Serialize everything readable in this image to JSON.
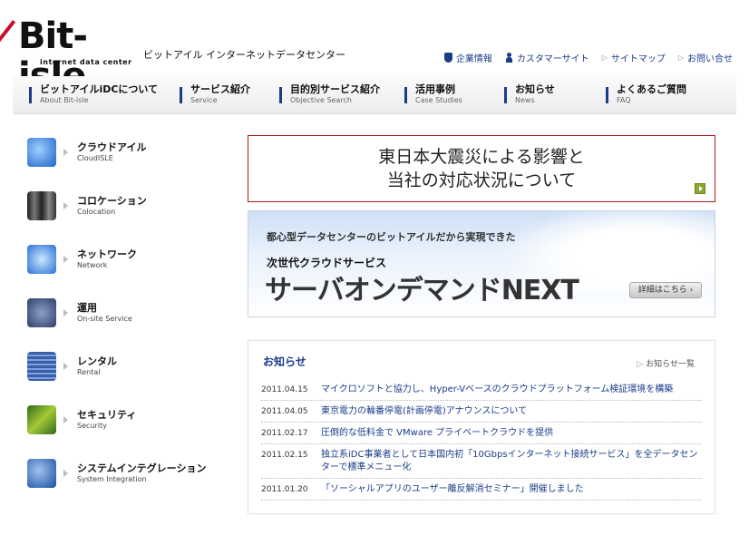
{
  "header": {
    "logo_text": "Bit-isle",
    "logo_sub": "internet data center",
    "tagline": "ビットアイル インターネットデータセンター",
    "utility": [
      {
        "label": "企業情報",
        "icon": "shield-icon"
      },
      {
        "label": "カスタマーサイト",
        "icon": "person-icon"
      },
      {
        "label": "サイトマップ",
        "icon": "arrow-icon"
      },
      {
        "label": "お問い合せ",
        "icon": "arrow-icon"
      }
    ]
  },
  "nav": [
    {
      "jp": "ビットアイルiDCについて",
      "en": "About Bit-isle"
    },
    {
      "jp": "サービス紹介",
      "en": "Service"
    },
    {
      "jp": "目的別サービス紹介",
      "en": "Objective Search"
    },
    {
      "jp": "活用事例",
      "en": "Case Studies"
    },
    {
      "jp": "お知らせ",
      "en": "News"
    },
    {
      "jp": "よくあるご質問",
      "en": "FAQ"
    }
  ],
  "services": [
    {
      "jp": "クラウドアイル",
      "en": "CloudISLE"
    },
    {
      "jp": "コロケーション",
      "en": "Colocation"
    },
    {
      "jp": "ネットワーク",
      "en": "Network"
    },
    {
      "jp": "運用",
      "en": "On-site Service"
    },
    {
      "jp": "レンタル",
      "en": "Rental"
    },
    {
      "jp": "セキュリティ",
      "en": "Security"
    },
    {
      "jp": "システムインテグレーション",
      "en": "System Integration"
    }
  ],
  "notice": {
    "line1": "東日本大震災による影響と",
    "line2": "当社の対応状況について"
  },
  "promo": {
    "line1": "都心型データセンターのビットアイルだから実現できた",
    "line2": "次世代クラウドサービス",
    "line3": "サーバオンデマンドNEXT",
    "button": "詳細はこちら ›"
  },
  "news": {
    "heading": "お知らせ",
    "all_link": "お知らせ一覧",
    "items": [
      {
        "date": "2011.04.15",
        "title": "マイクロソフトと協力し、Hyper-Vベースのクラウドプラットフォーム検証環境を構築"
      },
      {
        "date": "2011.04.05",
        "title": "東京電力の輪番停電(計画停電)アナウンスについて"
      },
      {
        "date": "2011.02.17",
        "title": "圧倒的な低料金で VMware プライベートクラウドを提供"
      },
      {
        "date": "2011.02.15",
        "title": "独立系iDC事業者として日本国内初「10Gbpsインターネット接続サービス」を全データセンターで標準メニュー化"
      },
      {
        "date": "2011.01.20",
        "title": "「ソーシャルアプリのユーザー離反解消セミナー」開催しました"
      }
    ]
  },
  "colors": {
    "brand_blue": "#1a3c8a",
    "notice_border": "#b01818",
    "logo_red": "#c8102e"
  }
}
